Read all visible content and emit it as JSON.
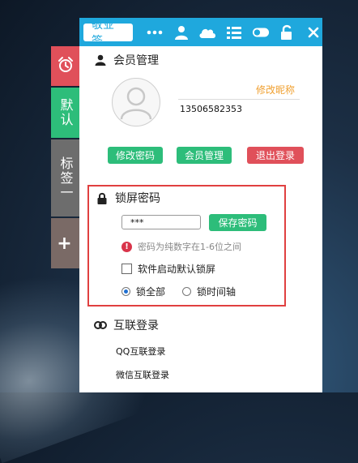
{
  "topbar": {
    "brand": "敬业签",
    "icons": [
      "more-icon",
      "user-icon",
      "cloud-icon",
      "list-icon",
      "toggle-icon",
      "unlock-icon",
      "close-icon"
    ]
  },
  "side_tabs": {
    "alarm_icon": "alarm-clock-icon",
    "default_label": "默认",
    "tag_label": "标签一",
    "add_label": "+"
  },
  "member": {
    "title": "会员管理",
    "edit_nickname": "修改昵称",
    "phone": "13506582353",
    "buttons": {
      "change_password": "修改密码",
      "member_manage": "会员管理",
      "logout": "退出登录"
    }
  },
  "lock_screen": {
    "title": "锁屏密码",
    "password_value": "***",
    "save_button": "保存密码",
    "hint": "密码为纯数字在1-6位之间",
    "auto_lock_label": "软件启动默认锁屏",
    "auto_lock_checked": false,
    "options": [
      {
        "label": "锁全部",
        "selected": true
      },
      {
        "label": "锁时间轴",
        "selected": false
      }
    ]
  },
  "federated_login": {
    "title": "互联登录",
    "items": [
      "QQ互联登录",
      "微信互联登录"
    ]
  },
  "colors": {
    "topbar": "#1fa8dd",
    "green": "#2dbd7a",
    "red": "#e0505a",
    "nickname_link": "#f0a030",
    "highlight_border": "#e04040"
  }
}
